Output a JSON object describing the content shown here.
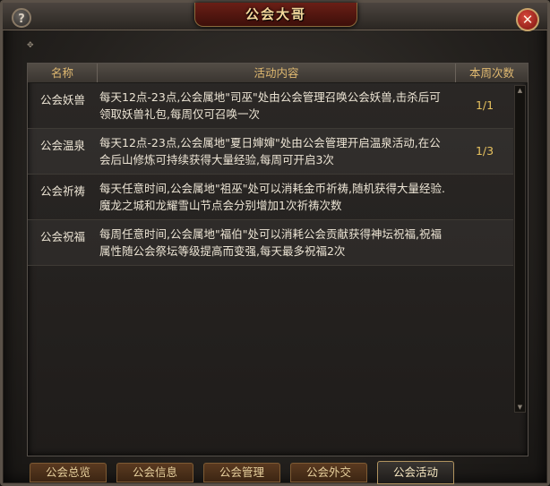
{
  "window": {
    "title": "公会大哥",
    "help_label": "?",
    "close_label": "✕",
    "corner_glyph": "✥"
  },
  "table": {
    "headers": {
      "name": "名称",
      "content": "活动内容",
      "count": "本周次数"
    },
    "rows": [
      {
        "name": "公会妖兽",
        "content": "每天12点-23点,公会属地\"司巫\"处由公会管理召唤公会妖兽,击杀后可领取妖兽礼包,每周仅可召唤一次",
        "count": "1/1"
      },
      {
        "name": "公会温泉",
        "content": "每天12点-23点,公会属地\"夏日婶婶\"处由公会管理开启温泉活动,在公会后山修炼可持续获得大量经验,每周可开启3次",
        "count": "1/3"
      },
      {
        "name": "公会祈祷",
        "content": "每天任意时间,公会属地\"祖巫\"处可以消耗金币祈祷,随机获得大量经验.魔龙之城和龙耀雪山节点会分别增加1次祈祷次数",
        "count": ""
      },
      {
        "name": "公会祝福",
        "content": "每周任意时间,公会属地\"福伯\"处可以消耗公会贡献获得神坛祝福,祝福属性随公会祭坛等级提高而变强,每天最多祝福2次",
        "count": ""
      }
    ],
    "scroll_up": "▲",
    "scroll_down": "▼"
  },
  "tabs": [
    {
      "label": "公会总览",
      "active": false
    },
    {
      "label": "公会信息",
      "active": false
    },
    {
      "label": "公会管理",
      "active": false
    },
    {
      "label": "公会外交",
      "active": false
    },
    {
      "label": "公会活动",
      "active": true
    }
  ],
  "colors": {
    "title": "#f3d69a",
    "header_text": "#e0b970",
    "count_text": "#e7c25f",
    "body_text": "#ece4d4"
  }
}
